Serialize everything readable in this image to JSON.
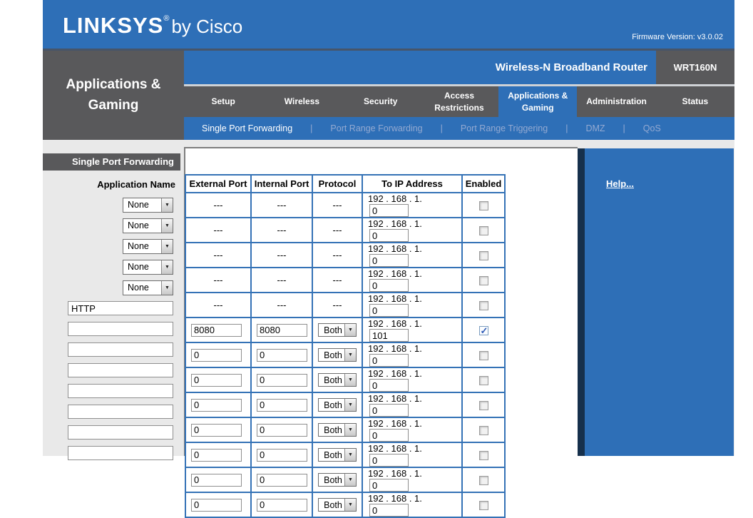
{
  "colors": {
    "brand_blue": "#2e6fb7",
    "dark_gray": "#59595b",
    "table_border": "#3472b6",
    "subnav_inactive": "#93a9d1"
  },
  "header": {
    "logo_text": "LINKSYS",
    "logo_reg": "®",
    "logo_suffix": "by Cisco",
    "firmware_version": "Firmware Version: v3.0.02"
  },
  "banner": {
    "router_name": "Wireless-N Broadband Router",
    "model": "WRT160N"
  },
  "nav_tabs": [
    {
      "label": "Setup",
      "active": false
    },
    {
      "label": "Wireless",
      "active": false
    },
    {
      "label": "Security",
      "active": false
    },
    {
      "label": "Access Restrictions",
      "active": false
    },
    {
      "label": "Applications & Gaming",
      "active": true
    },
    {
      "label": "Administration",
      "active": false
    },
    {
      "label": "Status",
      "active": false
    }
  ],
  "subnav": {
    "separator": "|",
    "items": [
      {
        "label": "Single Port Forwarding",
        "active": true
      },
      {
        "label": "Port Range Forwarding",
        "active": false
      },
      {
        "label": "Port Range Triggering",
        "active": false
      },
      {
        "label": "DMZ",
        "active": false
      },
      {
        "label": "QoS",
        "active": false
      }
    ]
  },
  "sidebar": {
    "section_title": "Applications & Gaming",
    "panel_label": "Single Port Forwarding",
    "application_name_label": "Application Name",
    "application_selects": [
      "None",
      "None",
      "None",
      "None",
      "None"
    ],
    "application_inputs": [
      "HTTP",
      "",
      "",
      "",
      "",
      "",
      "",
      ""
    ]
  },
  "port_table": {
    "headers": [
      "External Port",
      "Internal Port",
      "Protocol",
      "To IP Address",
      "Enabled"
    ],
    "ip_prefix": "192 . 168 . 1.",
    "placeholder": "---",
    "rows": [
      {
        "editable": false,
        "external": "---",
        "internal": "---",
        "protocol": "---",
        "ip_last_octet": "0",
        "enabled": false
      },
      {
        "editable": false,
        "external": "---",
        "internal": "---",
        "protocol": "---",
        "ip_last_octet": "0",
        "enabled": false
      },
      {
        "editable": false,
        "external": "---",
        "internal": "---",
        "protocol": "---",
        "ip_last_octet": "0",
        "enabled": false
      },
      {
        "editable": false,
        "external": "---",
        "internal": "---",
        "protocol": "---",
        "ip_last_octet": "0",
        "enabled": false
      },
      {
        "editable": false,
        "external": "---",
        "internal": "---",
        "protocol": "---",
        "ip_last_octet": "0",
        "enabled": false
      },
      {
        "editable": true,
        "external": "8080",
        "internal": "8080",
        "protocol": "Both",
        "ip_last_octet": "101",
        "enabled": true
      },
      {
        "editable": true,
        "external": "0",
        "internal": "0",
        "protocol": "Both",
        "ip_last_octet": "0",
        "enabled": false
      },
      {
        "editable": true,
        "external": "0",
        "internal": "0",
        "protocol": "Both",
        "ip_last_octet": "0",
        "enabled": false
      },
      {
        "editable": true,
        "external": "0",
        "internal": "0",
        "protocol": "Both",
        "ip_last_octet": "0",
        "enabled": false
      },
      {
        "editable": true,
        "external": "0",
        "internal": "0",
        "protocol": "Both",
        "ip_last_octet": "0",
        "enabled": false
      },
      {
        "editable": true,
        "external": "0",
        "internal": "0",
        "protocol": "Both",
        "ip_last_octet": "0",
        "enabled": false
      },
      {
        "editable": true,
        "external": "0",
        "internal": "0",
        "protocol": "Both",
        "ip_last_octet": "0",
        "enabled": false
      },
      {
        "editable": true,
        "external": "0",
        "internal": "0",
        "protocol": "Both",
        "ip_last_octet": "0",
        "enabled": false
      }
    ]
  },
  "help": {
    "link_label": "Help..."
  }
}
